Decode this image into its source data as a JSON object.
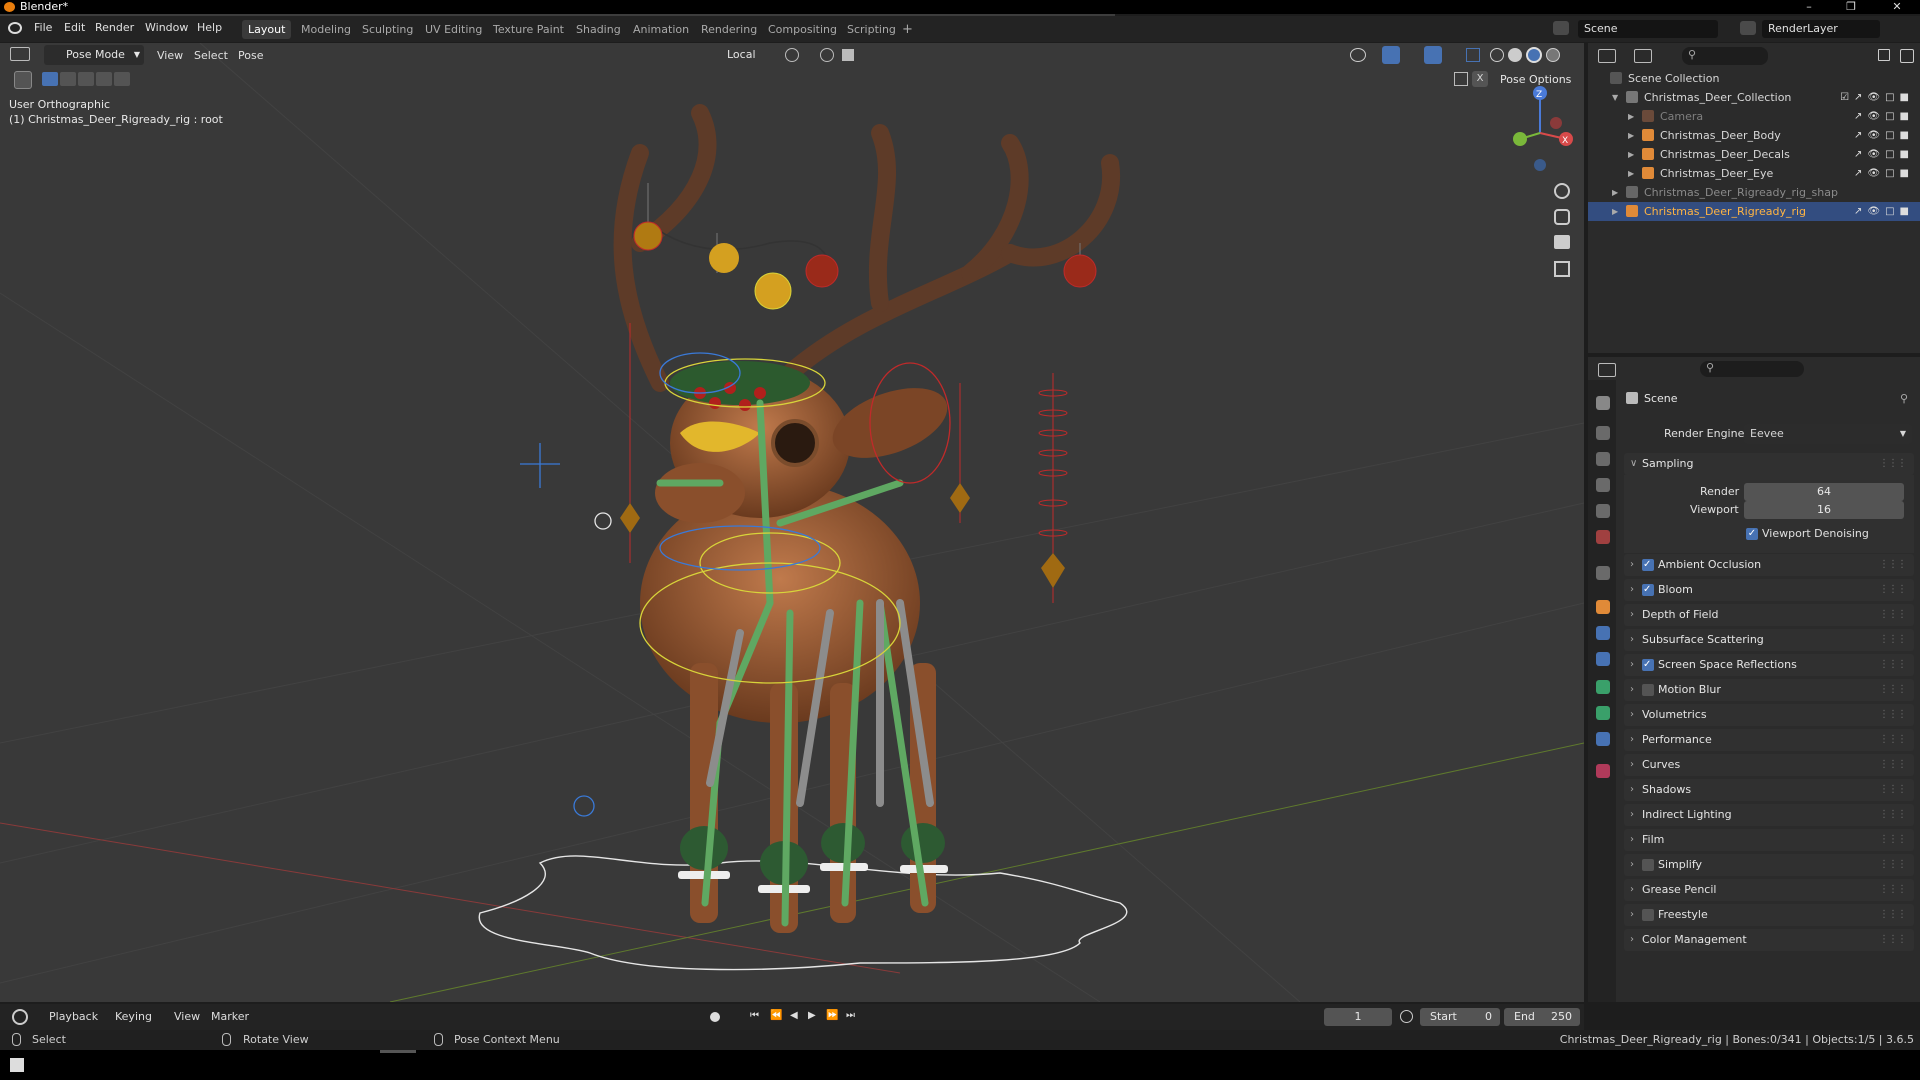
{
  "window": {
    "title": "Blender*",
    "controls": [
      "–",
      "❐",
      "✕"
    ]
  },
  "menu": [
    "File",
    "Edit",
    "Render",
    "Window",
    "Help"
  ],
  "workspaces": {
    "tabs": [
      "Layout",
      "Modeling",
      "Sculpting",
      "UV Editing",
      "Texture Paint",
      "Shading",
      "Animation",
      "Rendering",
      "Compositing",
      "Scripting"
    ],
    "active": "Layout",
    "add": "+"
  },
  "scene_selector": {
    "scene": "Scene",
    "view_layer": "RenderLayer"
  },
  "viewport": {
    "mode": "Pose Mode",
    "menus": [
      "View",
      "Select",
      "Pose"
    ],
    "transform_orientation": "Local",
    "pose_options": "Pose Options",
    "view_name": "User Orthographic",
    "active_object": "(1) Christmas_Deer_Rigready_rig : root",
    "gizmo_axes": [
      "Z",
      "X",
      "Y"
    ]
  },
  "outliner": {
    "root": "Scene Collection",
    "rows": [
      {
        "label": "Christmas_Deer_Collection",
        "indent": 1,
        "kind": "collection"
      },
      {
        "label": "Camera",
        "indent": 2,
        "kind": "camera"
      },
      {
        "label": "Christmas_Deer_Body",
        "indent": 2,
        "kind": "mesh"
      },
      {
        "label": "Christmas_Deer_Decals",
        "indent": 2,
        "kind": "mesh"
      },
      {
        "label": "Christmas_Deer_Eye",
        "indent": 2,
        "kind": "mesh"
      },
      {
        "label": "Christmas_Deer_Rigready_rig_shap",
        "indent": 1,
        "kind": "collection"
      },
      {
        "label": "Christmas_Deer_Rigready_rig",
        "indent": 1,
        "kind": "armature",
        "selected": true
      }
    ]
  },
  "properties": {
    "context": "Scene",
    "render_engine_label": "Render Engine",
    "render_engine": "Eevee",
    "sampling": {
      "title": "Sampling",
      "render_label": "Render",
      "render": "64",
      "viewport_label": "Viewport",
      "viewport": "16",
      "denoising": "Viewport Denoising"
    },
    "panels": [
      {
        "label": "Ambient Occlusion",
        "checkbox": true,
        "checked": true
      },
      {
        "label": "Bloom",
        "checkbox": true,
        "checked": true
      },
      {
        "label": "Depth of Field",
        "checkbox": false
      },
      {
        "label": "Subsurface Scattering",
        "checkbox": false
      },
      {
        "label": "Screen Space Reflections",
        "checkbox": true,
        "checked": true
      },
      {
        "label": "Motion Blur",
        "checkbox": true,
        "checked": false
      },
      {
        "label": "Volumetrics",
        "checkbox": false
      },
      {
        "label": "Performance",
        "checkbox": false
      },
      {
        "label": "Curves",
        "checkbox": false
      },
      {
        "label": "Shadows",
        "checkbox": false
      },
      {
        "label": "Indirect Lighting",
        "checkbox": false
      },
      {
        "label": "Film",
        "checkbox": false
      },
      {
        "label": "Simplify",
        "checkbox": true,
        "checked": false
      },
      {
        "label": "Grease Pencil",
        "checkbox": false
      },
      {
        "label": "Freestyle",
        "checkbox": true,
        "checked": false
      },
      {
        "label": "Color Management",
        "checkbox": false
      }
    ]
  },
  "timeline": {
    "menus": [
      "Playback",
      "Keying",
      "View",
      "Marker"
    ],
    "current_frame": "1",
    "start_label": "Start",
    "start": "0",
    "end_label": "End",
    "end": "250"
  },
  "statusbar": {
    "left": "Select",
    "middle": "Rotate View",
    "right_hint": "Pose Context Menu",
    "info": "Christmas_Deer_Rigready_rig | Bones:0/341 | Objects:1/5 | 3.6.5"
  },
  "colors": {
    "accent": "#4772b3",
    "selected_text": "#ffb443",
    "viewport_bg": "#393939",
    "panel_bg": "#2b2b2b"
  }
}
